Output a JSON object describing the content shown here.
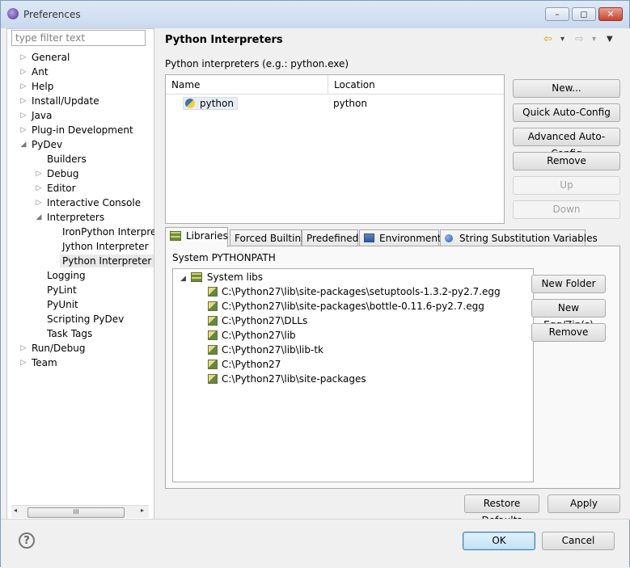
{
  "window": {
    "title": "Preferences",
    "controls": {
      "minimize": "–",
      "maximize": "◻",
      "close": "✕"
    }
  },
  "filter": {
    "placeholder": "type filter text"
  },
  "tree": [
    {
      "label": "General",
      "twisty": "▷"
    },
    {
      "label": "Ant",
      "twisty": "▷"
    },
    {
      "label": "Help",
      "twisty": "▷"
    },
    {
      "label": "Install/Update",
      "twisty": "▷"
    },
    {
      "label": "Java",
      "twisty": "▷"
    },
    {
      "label": "Plug-in Development",
      "twisty": "▷"
    },
    {
      "label": "PyDev",
      "twisty": "◢"
    },
    {
      "label": "Builders",
      "twisty": ""
    },
    {
      "label": "Debug",
      "twisty": "▷"
    },
    {
      "label": "Editor",
      "twisty": "▷"
    },
    {
      "label": "Interactive Console",
      "twisty": "▷"
    },
    {
      "label": "Interpreters",
      "twisty": "◢"
    },
    {
      "label": "IronPython Interpre",
      "twisty": ""
    },
    {
      "label": "Jython Interpreter",
      "twisty": ""
    },
    {
      "label": "Python Interpreter",
      "twisty": ""
    },
    {
      "label": "Logging",
      "twisty": ""
    },
    {
      "label": "PyLint",
      "twisty": ""
    },
    {
      "label": "PyUnit",
      "twisty": ""
    },
    {
      "label": "Scripting PyDev",
      "twisty": ""
    },
    {
      "label": "Task Tags",
      "twisty": ""
    },
    {
      "label": "Run/Debug",
      "twisty": "▷"
    },
    {
      "label": "Team",
      "twisty": "▷"
    }
  ],
  "page": {
    "title": "Python Interpreters",
    "subtitle": "Python interpreters (e.g.: python.exe)",
    "nav": {
      "back": "⇦",
      "back_menu": "▾",
      "forward": "⇨",
      "forward_menu": "▾",
      "view_menu": "▼"
    }
  },
  "interpreters_table": {
    "columns": [
      "Name",
      "Location"
    ],
    "rows": [
      {
        "name": "python",
        "location": "python"
      }
    ]
  },
  "interpreter_buttons": {
    "new": "New...",
    "quick": "Quick Auto-Config",
    "advanced": "Advanced Auto-Config",
    "remove": "Remove",
    "up": "Up",
    "down": "Down"
  },
  "tabs": [
    "Libraries",
    "Forced Builtins",
    "Predefined",
    "Environment",
    "String Substitution Variables"
  ],
  "libraries": {
    "label": "System PYTHONPATH",
    "root": "System libs",
    "items": [
      "C:\\Python27\\lib\\site-packages\\setuptools-1.3.2-py2.7.egg",
      "C:\\Python27\\lib\\site-packages\\bottle-0.11.6-py2.7.egg",
      "C:\\Python27\\DLLs",
      "C:\\Python27\\lib",
      "C:\\Python27\\lib\\lib-tk",
      "C:\\Python27",
      "C:\\Python27\\lib\\site-packages"
    ]
  },
  "library_buttons": {
    "new_folder": "New Folder",
    "new_egg": "New Egg/Zip(s)",
    "remove": "Remove"
  },
  "page_buttons": {
    "restore": "Restore Defaults",
    "apply": "Apply"
  },
  "footer": {
    "help": "?",
    "ok": "OK",
    "cancel": "Cancel"
  },
  "scrollbar": {
    "left": "◂",
    "grip": "III",
    "right": "▸"
  }
}
